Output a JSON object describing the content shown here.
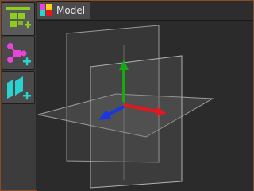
{
  "toolbar": {
    "items": [
      {
        "name": "select-add-tool",
        "color": "#8ccf1a"
      },
      {
        "name": "node-graph-add-tool",
        "color": "#e844d8"
      },
      {
        "name": "planes-add-tool",
        "color": "#2ad3cf"
      }
    ]
  },
  "tabs": [
    {
      "label": "Model",
      "active": true
    }
  ],
  "viewport": {
    "axis_colors": {
      "x": "#e8151b",
      "y": "#18a814",
      "z": "#1a35e8"
    }
  },
  "colors": {
    "frame_border": "#8a4a24",
    "viewport_bg": "#2b2b2b"
  }
}
